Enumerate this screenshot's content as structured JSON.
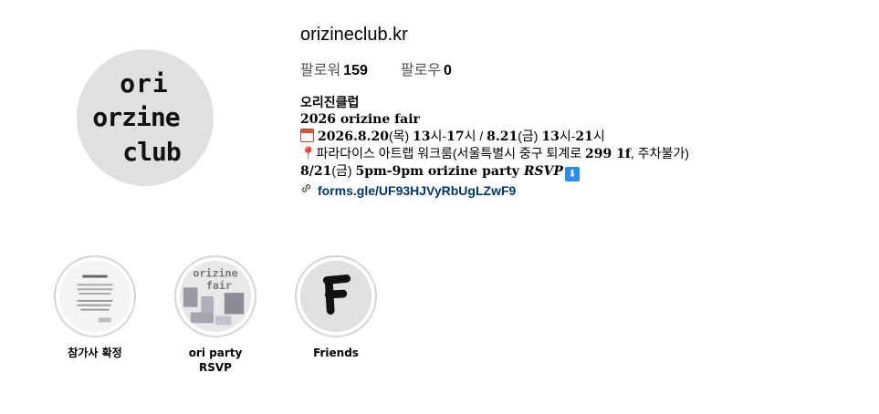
{
  "profile": {
    "username": "orizineclub.kr",
    "avatar_icon": "orizine-club-logo",
    "stats": {
      "followers_label": "팔로워",
      "followers_count": "159",
      "following_label": "팔로우",
      "following_count": "0"
    },
    "bio": {
      "name": "오리진클럽",
      "line1": "2026 orizine fair",
      "line2_emoji": "calendar-icon",
      "line2_a": "2026.8.20",
      "line2_b": "(목) ",
      "line2_c": "13",
      "line2_d": "시-",
      "line2_e": "17",
      "line2_f": "시 / ",
      "line2_g": "8.21",
      "line2_h": "(금) ",
      "line2_i": "13",
      "line2_j": "시-",
      "line2_k": "21",
      "line2_l": "시",
      "line3_pin": "📍",
      "line3_a": "파라다이스 아트랩 워크룸(서울특별시 중구 퇴계로 ",
      "line3_b": "299 1f",
      "line3_c": ", 주차불가)",
      "line4_a": "8/21",
      "line4_b": "(금) ",
      "line4_c": "5pm-9pm orizine party ",
      "line4_d": "RSVP",
      "line4_arrow": "⬇",
      "link_icon": "link-icon",
      "link_text": "forms.gle/UF93HJVyRbUgLZwF9"
    }
  },
  "highlights": [
    {
      "label": "참가사 확정",
      "icon": "document-thumbnail"
    },
    {
      "label": "ori party RSVP",
      "icon": "orizine-fair-thumbnail"
    },
    {
      "label": "Friends",
      "icon": "letter-f-thumbnail"
    }
  ],
  "colors": {
    "link": "#00376b",
    "ring": "#d6d6d6",
    "avatar_bg": "#e0e0e0",
    "muted": "#555555"
  }
}
